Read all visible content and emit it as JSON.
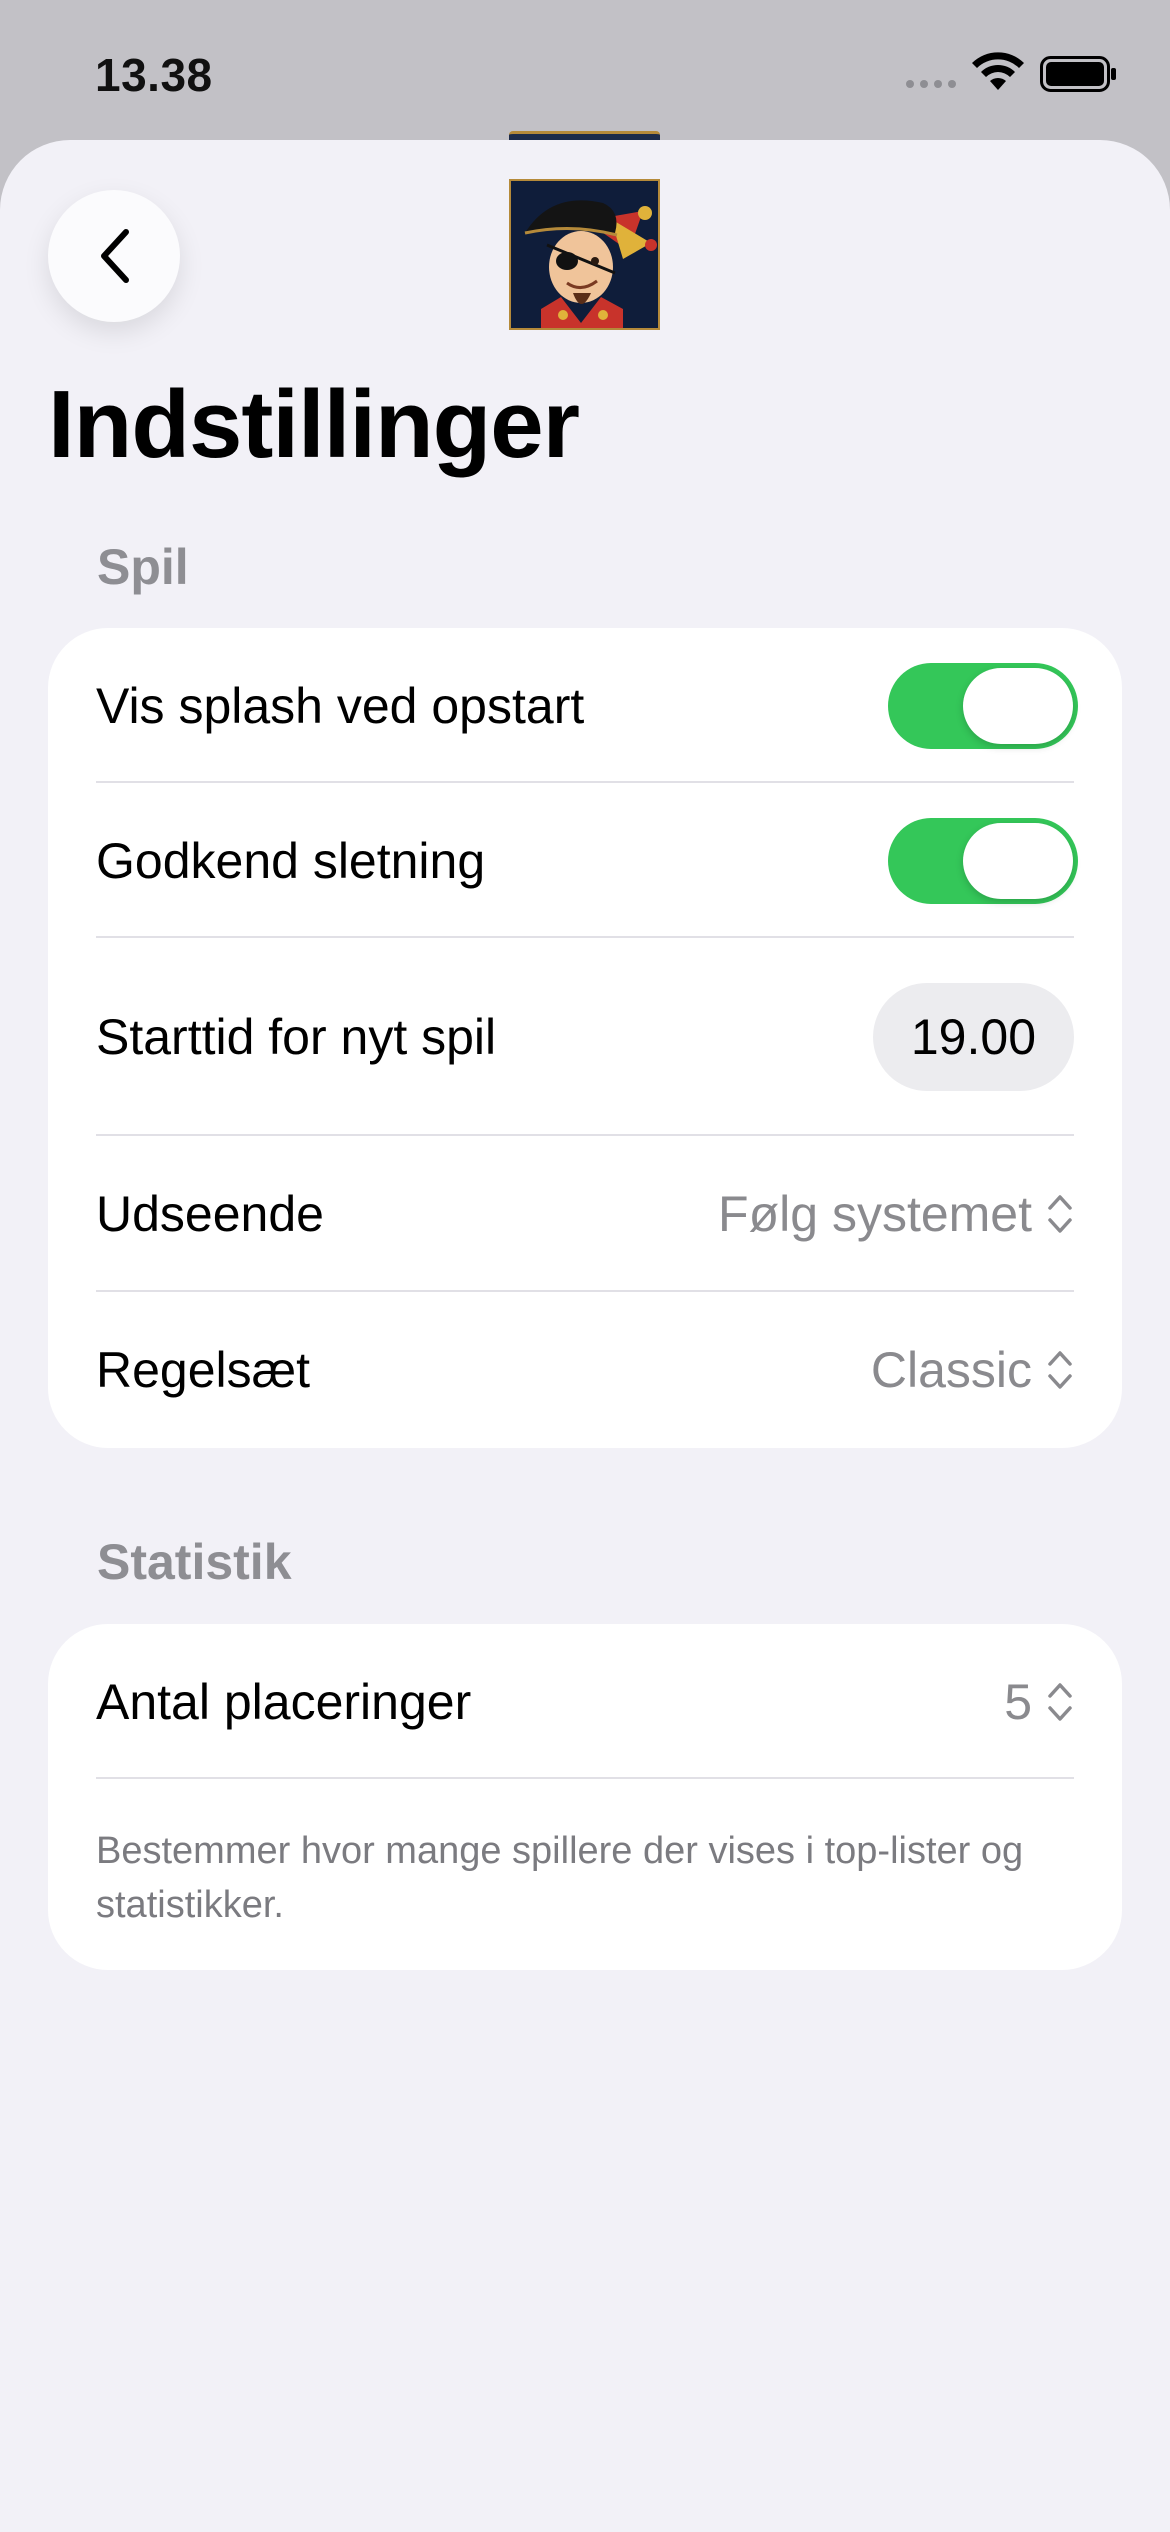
{
  "status_bar": {
    "time": "13.38"
  },
  "page": {
    "title": "Indstillinger"
  },
  "sections": {
    "spil": {
      "header": "Spil",
      "show_splash_label": "Vis splash ved opstart",
      "show_splash_on": true,
      "confirm_delete_label": "Godkend sletning",
      "confirm_delete_on": true,
      "start_time_label": "Starttid for nyt spil",
      "start_time_value": "19.00",
      "appearance_label": "Udseende",
      "appearance_value": "Følg systemet",
      "ruleset_label": "Regelsæt",
      "ruleset_value": "Classic"
    },
    "statistik": {
      "header": "Statistik",
      "placements_label": "Antal placeringer",
      "placements_value": "5",
      "footnote": "Bestemmer hvor mange spillere der vises i top-lister og statistikker."
    }
  },
  "icons": {
    "back": "chevron-left-icon",
    "app_logo": "jester-pirate-logo",
    "picker": "chevron-up-down-icon"
  },
  "colors": {
    "toggle_on": "#34c759",
    "background": "#f2f1f7",
    "secondary_text": "#8e8e93"
  }
}
